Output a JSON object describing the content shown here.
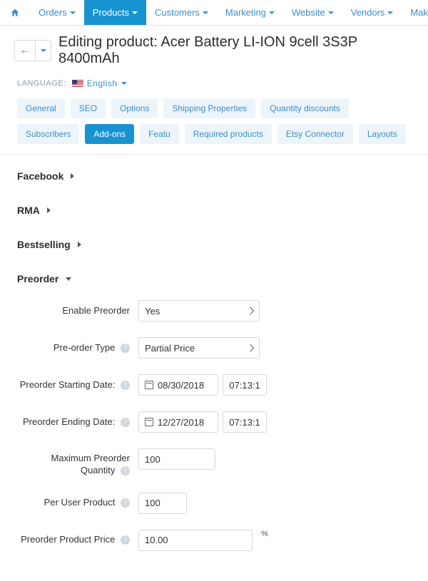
{
  "nav": {
    "home": "",
    "items": [
      {
        "label": "Orders"
      },
      {
        "label": "Products",
        "active": true
      },
      {
        "label": "Customers"
      },
      {
        "label": "Marketing"
      },
      {
        "label": "Website"
      },
      {
        "label": "Vendors"
      },
      {
        "label": "Make An Offer"
      }
    ]
  },
  "header": {
    "title": "Editing product: Acer Battery LI-ION 9cell 3S3P 8400mAh",
    "back_glyph": "←"
  },
  "language": {
    "label": "LANGUAGE:",
    "value": "English"
  },
  "tabs": [
    {
      "label": "General"
    },
    {
      "label": "SEO"
    },
    {
      "label": "Options"
    },
    {
      "label": "Shipping Properties"
    },
    {
      "label": "Quantity discounts"
    },
    {
      "label": "Subscribers"
    },
    {
      "label": "Add-ons",
      "active": true
    },
    {
      "label": "Featu",
      "cutoff": true
    },
    {
      "label": "Required products"
    },
    {
      "label": "Etsy Connector"
    },
    {
      "label": "Layouts"
    }
  ],
  "sections": {
    "facebook": "Facebook",
    "rma": "RMA",
    "bestselling": "Bestselling",
    "preorder": "Preorder"
  },
  "preorder": {
    "enable_label": "Enable Preorder",
    "enable_value": "Yes",
    "type_label": "Pre-order Type",
    "type_value": "Partial Price",
    "start_label": "Preorder Starting Date:",
    "start_date": "08/30/2018",
    "start_time": "07:13:1",
    "end_label": "Preorder Ending Date:",
    "end_date": "12/27/2018",
    "end_time": "07:13:1",
    "max_qty_label": "Maximum Preorder Quantity",
    "max_qty_value": "100",
    "per_user_label": "Per User Product",
    "per_user_value": "100",
    "price_label": "Preorder Product Price",
    "price_value": "10.00",
    "price_suffix": "%"
  }
}
